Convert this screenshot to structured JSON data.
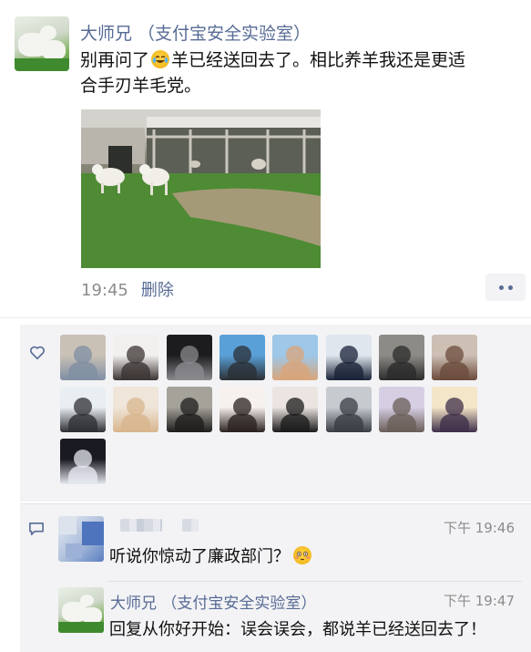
{
  "post": {
    "author": "大师兄 （支付宝安全实验室）",
    "text_before_emoji": "别再问了",
    "emoji": "laugh-cry-emoji",
    "text_after_emoji": "羊已经送回去了。相比养羊我还是更适合手刃羊毛党。",
    "time": "19:45",
    "delete_label": "删除"
  },
  "likes": {
    "icon": "heart-icon",
    "avatars": [
      {
        "name": "liker-avatar-1",
        "colors": [
          "#c9c1b6",
          "#7f8ea3"
        ]
      },
      {
        "name": "liker-avatar-2",
        "colors": [
          "#f2f0ee",
          "#3b3433"
        ]
      },
      {
        "name": "liker-avatar-3",
        "colors": [
          "#1c1c1f",
          "#8a8a8e"
        ]
      },
      {
        "name": "liker-avatar-4",
        "colors": [
          "#5aa0d8",
          "#2b2f34"
        ]
      },
      {
        "name": "liker-avatar-5",
        "colors": [
          "#9ec7e8",
          "#d9a57a"
        ]
      },
      {
        "name": "liker-avatar-6",
        "colors": [
          "#dfe6ee",
          "#1a2338"
        ]
      },
      {
        "name": "liker-avatar-7",
        "colors": [
          "#8d8b86",
          "#2b2b2b"
        ]
      },
      {
        "name": "liker-avatar-8",
        "colors": [
          "#cdbfb4",
          "#6b4b3c"
        ]
      },
      {
        "name": "liker-avatar-9",
        "colors": [
          "#e9eef3",
          "#2e2f33"
        ]
      },
      {
        "name": "liker-avatar-10",
        "colors": [
          "#efe5d9",
          "#d8b58d"
        ]
      },
      {
        "name": "liker-avatar-11",
        "colors": [
          "#a5a29a",
          "#1f1d1d"
        ]
      },
      {
        "name": "liker-avatar-12",
        "colors": [
          "#f7f1ee",
          "#2a2220"
        ]
      },
      {
        "name": "liker-avatar-13",
        "colors": [
          "#ebe4e0",
          "#1b1b1b"
        ]
      },
      {
        "name": "liker-avatar-14",
        "colors": [
          "#c7cbd0",
          "#3a3d44"
        ]
      },
      {
        "name": "liker-avatar-15",
        "colors": [
          "#d6cfe4",
          "#6a5e58"
        ]
      },
      {
        "name": "liker-avatar-16",
        "colors": [
          "#f4e6c8",
          "#3f2f4a"
        ]
      },
      {
        "name": "liker-avatar-17",
        "colors": [
          "#1a1a22",
          "#e7e9f1"
        ]
      }
    ]
  },
  "comments": {
    "icon": "comment-icon",
    "items": [
      {
        "author_blurred": true,
        "time": "下午 19:46",
        "text": "听说你惊动了廉政部门？",
        "emoji": "flushed-emoji"
      },
      {
        "author": "大师兄 （支付宝安全实验室）",
        "time": "下午 19:47",
        "text": "回复从你好开始：误会误会，都说羊已经送回去了！"
      }
    ]
  }
}
